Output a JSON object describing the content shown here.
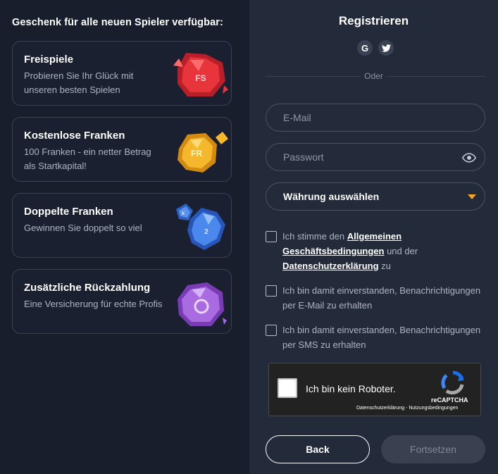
{
  "promo": {
    "title": "Geschenk für alle neuen Spieler verfügbar:",
    "cards": [
      {
        "title": "Freispiele",
        "desc": "Probieren Sie Ihr Glück mit unseren besten Spielen",
        "icon": "red-gem-icon",
        "icon_text": "FS",
        "color": "#e2333a"
      },
      {
        "title": "Kostenlose Franken",
        "desc": "100 Franken - ein netter Betrag als Startkapital!",
        "icon": "gold-gem-icon",
        "icon_text": "FR",
        "color": "#f2b52a"
      },
      {
        "title": "Doppelte Franken",
        "desc": "Gewinnen Sie doppelt so viel",
        "icon": "blue-gems-icon",
        "icon_text": "2",
        "icon_text_small": "x",
        "color": "#3a78e0"
      },
      {
        "title": "Zusätzliche Rückzahlung",
        "desc": "Eine Versicherung für echte Profis",
        "icon": "purple-gem-icon",
        "icon_text": "",
        "color": "#9b5fd6"
      }
    ]
  },
  "register": {
    "title": "Registrieren",
    "social": [
      {
        "icon": "google-icon",
        "glyph": "G"
      },
      {
        "icon": "twitter-icon",
        "glyph": "🐦"
      }
    ],
    "divider_text": "Oder",
    "email_placeholder": "E-Mail",
    "password_placeholder": "Passwort",
    "currency_label": "Währung auswählen",
    "checkbox_terms": {
      "prefix": "Ich stimme den ",
      "link1": "Allgemeinen Geschäftsbedingungen",
      "middle": " und der ",
      "link2": "Datenschutzerklärung",
      "suffix": " zu"
    },
    "checkbox_email": "Ich bin damit einverstanden, Benachrichtigungen per E-Mail zu erhalten",
    "checkbox_sms": "Ich bin damit einverstanden, Benachrichtigungen per SMS zu erhalten",
    "captcha": {
      "label": "Ich bin kein Roboter.",
      "brand": "reCAPTCHA",
      "links": "Datenschutzerklärung - Nutzungsbedingungen"
    },
    "back_label": "Back",
    "next_label": "Fortsetzen"
  },
  "colors": {
    "accent": "#f2a42b",
    "panel_left": "#181e2c",
    "panel_right": "#232a3a"
  }
}
